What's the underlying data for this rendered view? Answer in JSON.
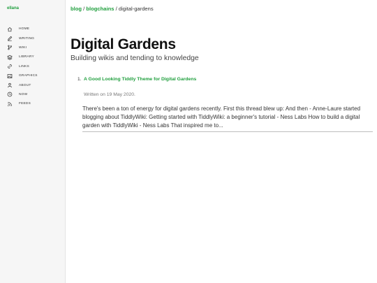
{
  "site": {
    "brand": "ellana"
  },
  "sidebar": {
    "items": [
      {
        "label": "HOME",
        "icon": "home-icon"
      },
      {
        "label": "WRITING",
        "icon": "pen-icon"
      },
      {
        "label": "WIKI",
        "icon": "branch-icon"
      },
      {
        "label": "LIBRARY",
        "icon": "stack-icon"
      },
      {
        "label": "LINKS",
        "icon": "link-icon"
      },
      {
        "label": "GRAPHICS",
        "icon": "image-icon"
      },
      {
        "label": "ABOUT",
        "icon": "user-icon"
      },
      {
        "label": "NOW",
        "icon": "clock-icon"
      },
      {
        "label": "FEEDS",
        "icon": "rss-icon"
      }
    ]
  },
  "breadcrumb": {
    "items": [
      "blog",
      "blogchains",
      "digital-gardens"
    ],
    "separator": "/"
  },
  "page": {
    "title": "Digital Gardens",
    "subtitle": "Building wikis and tending to knowledge"
  },
  "posts": [
    {
      "number": "1.",
      "title": "A Good Looking Tiddly Theme for Digital Gardens",
      "date": "Written on 19 May 2020.",
      "excerpt": "There's been a ton of energy for digital gardens recently. First this thread blew up: And then - Anne-Laure started blogging about TiddlyWiki: Getting started with TiddlyWiki: a beginner's tutorial - Ness Labs How to build a digital garden with TiddlyWiki - Ness Labs That inspired me to..."
    }
  ],
  "colors": {
    "accent": "#1e9e3c",
    "sidebar_bg": "#f6f6f6"
  }
}
